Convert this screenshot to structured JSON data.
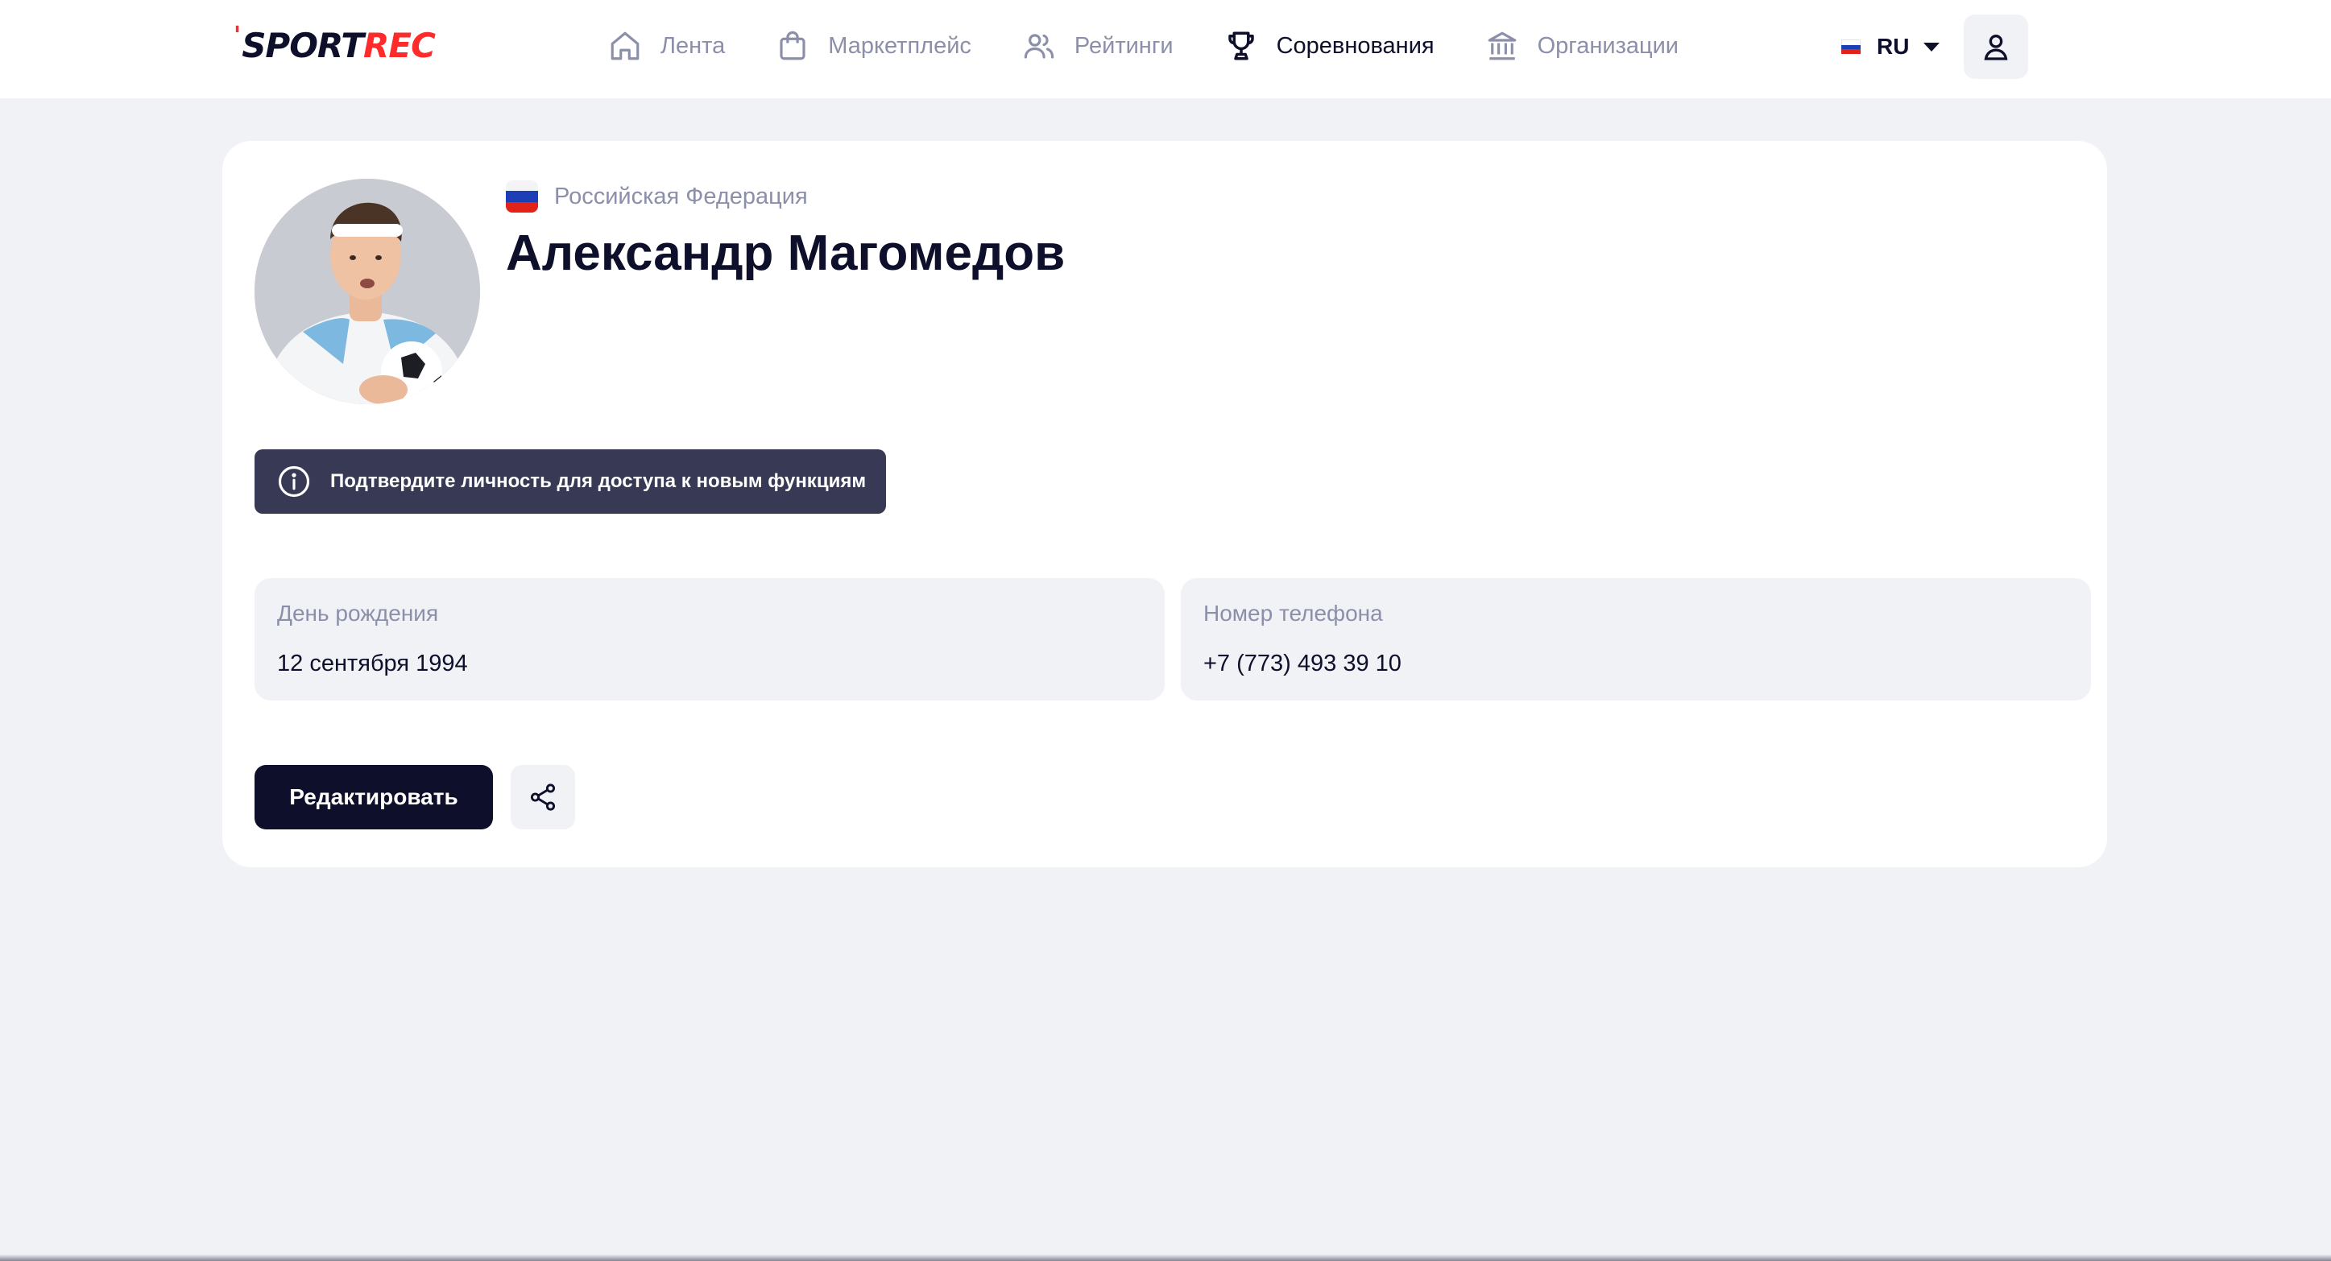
{
  "app": {
    "logo_part1": "SPORT",
    "logo_part2": "REC"
  },
  "nav": {
    "items": [
      {
        "label": "Лента",
        "icon": "home-icon",
        "active": false
      },
      {
        "label": "Маркетплейс",
        "icon": "shopping-bag-icon",
        "active": false
      },
      {
        "label": "Рейтинги",
        "icon": "users-icon",
        "active": false
      },
      {
        "label": "Соревнования",
        "icon": "trophy-icon",
        "active": true
      },
      {
        "label": "Организации",
        "icon": "institution-icon",
        "active": false
      }
    ]
  },
  "language": {
    "code": "RU",
    "flag": "russia-flag-icon"
  },
  "header": {
    "user_icon": "user-icon"
  },
  "profile": {
    "country": "Российская Федерация",
    "name": "Александр Магомедов",
    "verify_notice": "Подтвердите личность для доступа к новым функциям",
    "fields": {
      "birthday_label": "День рождения",
      "birthday_value": "12 сентября 1994",
      "phone_label": "Номер телефона",
      "phone_value": "+7 (773) 493 39 10"
    },
    "edit_label": "Редактировать"
  },
  "colors": {
    "accent": "#ff2a2a",
    "primary": "#0d0f2b",
    "muted": "#8b8fa9",
    "background": "#f1f2f6",
    "notice": "#383a55"
  }
}
